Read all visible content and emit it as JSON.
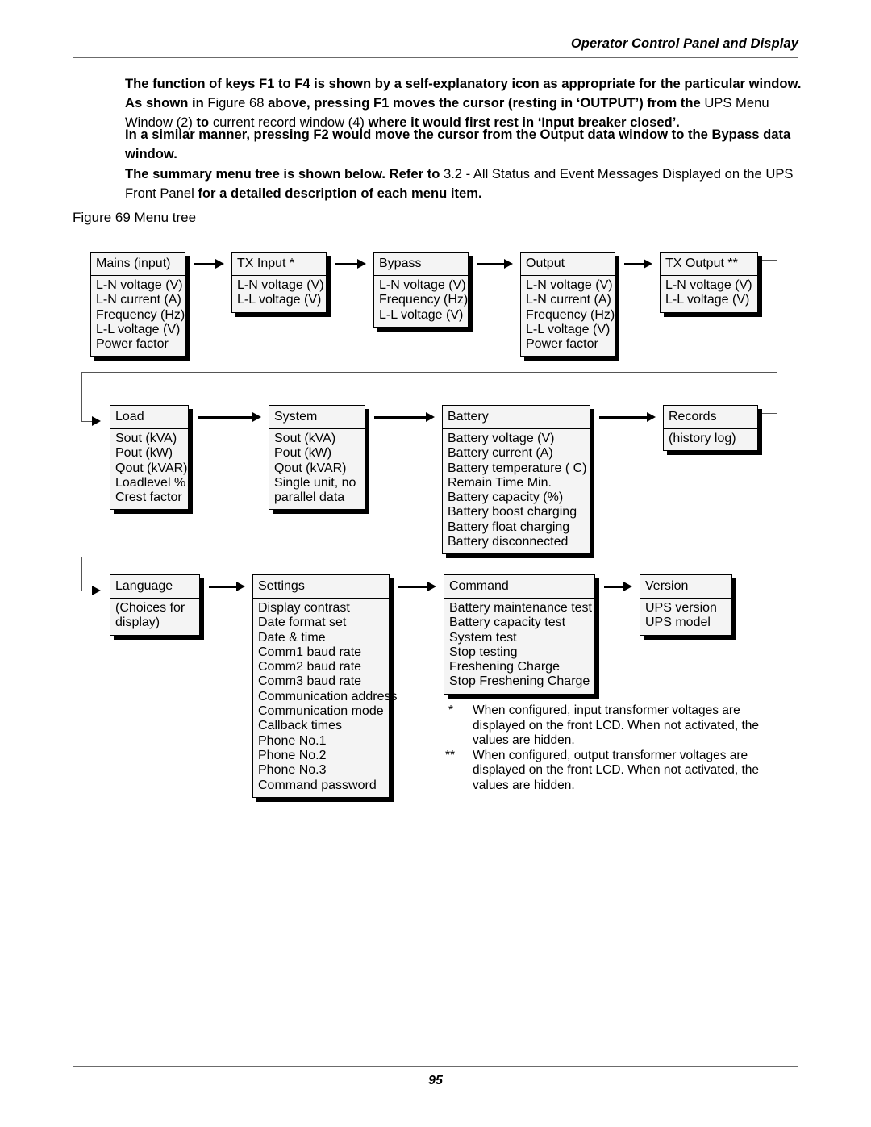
{
  "header": {
    "running_title": "Operator Control Panel and Display"
  },
  "footer": {
    "page_number": "95"
  },
  "body_text": {
    "paragraph1": [
      {
        "t": "The function of keys F1 to F4 is shown by a self",
        "b": true
      },
      {
        "t": "-explanatory icon as appropriate for the particular window. As shown in ",
        "b": true
      },
      {
        "t": "Figure 68 ",
        "b": false
      },
      {
        "t": " above, pressing F1 moves the cursor (resting in ",
        "b": true
      },
      {
        "t": "‘OUTPUT’",
        "b": true
      },
      {
        "t": ") from the ",
        "b": true
      },
      {
        "t": "UPS Menu Window (2) ",
        "b": false
      },
      {
        "t": "to ",
        "b": true
      },
      {
        "t": "current record window (4) ",
        "b": false
      },
      {
        "t": " where it would first rest in ‘Input breaker closed’.",
        "b": true
      }
    ],
    "paragraph2": [
      {
        "t": "In a similar manner, pressing F2 would move the cursor from the Output data window to the Bypass data window.",
        "b": true
      }
    ],
    "paragraph3": [
      {
        "t": "The summary menu tree is shown below. Refer to ",
        "b": true
      },
      {
        "t": "3.2 - All Status and Event Messages Displayed on the UPS Front Panel ",
        "b": false
      },
      {
        "t": " for a detailed description of each menu item.",
        "b": true
      }
    ],
    "figure_caption": "Figure 69  Menu tree"
  },
  "menu_tree": {
    "rows": [
      {
        "row_id": "row-1",
        "nodes": [
          {
            "title": "Mains (input)",
            "items": [
              "L-N voltage (V)",
              "L-N current (A)",
              "Frequency (Hz)",
              "L-L voltage (V)",
              "Power factor"
            ]
          },
          {
            "title": "TX Input *",
            "items": [
              "L-N voltage (V)",
              "L-L voltage (V)"
            ]
          },
          {
            "title": "Bypass",
            "items": [
              "L-N voltage (V)",
              "Frequency (Hz)",
              "L-L voltage (V)"
            ]
          },
          {
            "title": "Output",
            "items": [
              "L-N voltage (V)",
              "L-N current (A)",
              "Frequency (Hz)",
              "L-L voltage (V)",
              "Power factor"
            ]
          },
          {
            "title": "TX Output **",
            "items": [
              "L-N voltage (V)",
              "L-L voltage (V)"
            ]
          }
        ]
      },
      {
        "row_id": "row-2",
        "nodes": [
          {
            "title": "Load",
            "items": [
              "Sout (kVA)",
              "Pout (kW)",
              "Qout (kVAR)",
              "Loadlevel %",
              "Crest factor"
            ]
          },
          {
            "title": "System",
            "items": [
              "Sout (kVA)",
              "Pout (kW)",
              "Qout (kVAR)",
              "Single unit, no",
              "parallel data"
            ]
          },
          {
            "title": "Battery",
            "items": [
              "Battery voltage (V)",
              "Battery current (A)",
              "Battery temperature ( C)",
              "Remain Time Min.",
              "Battery capacity (%)",
              "Battery boost charging",
              "Battery float charging",
              "Battery disconnected"
            ]
          },
          {
            "title": "Records",
            "items": [
              "(history log)"
            ]
          }
        ]
      },
      {
        "row_id": "row-3",
        "nodes": [
          {
            "title": "Language",
            "items": [
              "(Choices for",
              "display)"
            ]
          },
          {
            "title": "Settings",
            "items": [
              "Display contrast",
              "Date format set",
              "Date & time",
              "Comm1 baud rate",
              "Comm2 baud rate",
              "Comm3 baud rate",
              "Communication address",
              "Communication mode",
              "Callback times",
              "Phone No.1",
              "Phone No.2",
              "Phone No.3",
              "Command password"
            ]
          },
          {
            "title": "Command",
            "items": [
              "Battery maintenance test",
              "Battery capacity test",
              "System test",
              "Stop testing",
              "Freshening Charge",
              "Stop Freshening Charge"
            ]
          },
          {
            "title": "Version",
            "items": [
              "UPS version",
              "UPS model"
            ]
          }
        ]
      }
    ]
  },
  "footnotes": [
    {
      "mark": "*",
      "text": "When configured, input transformer voltages are displayed on the front LCD. When not activated, the values are hidden."
    },
    {
      "mark": "**",
      "text": "When configured, output transformer voltages are displayed on the front LCD. When not activated, the values are hidden."
    }
  ]
}
